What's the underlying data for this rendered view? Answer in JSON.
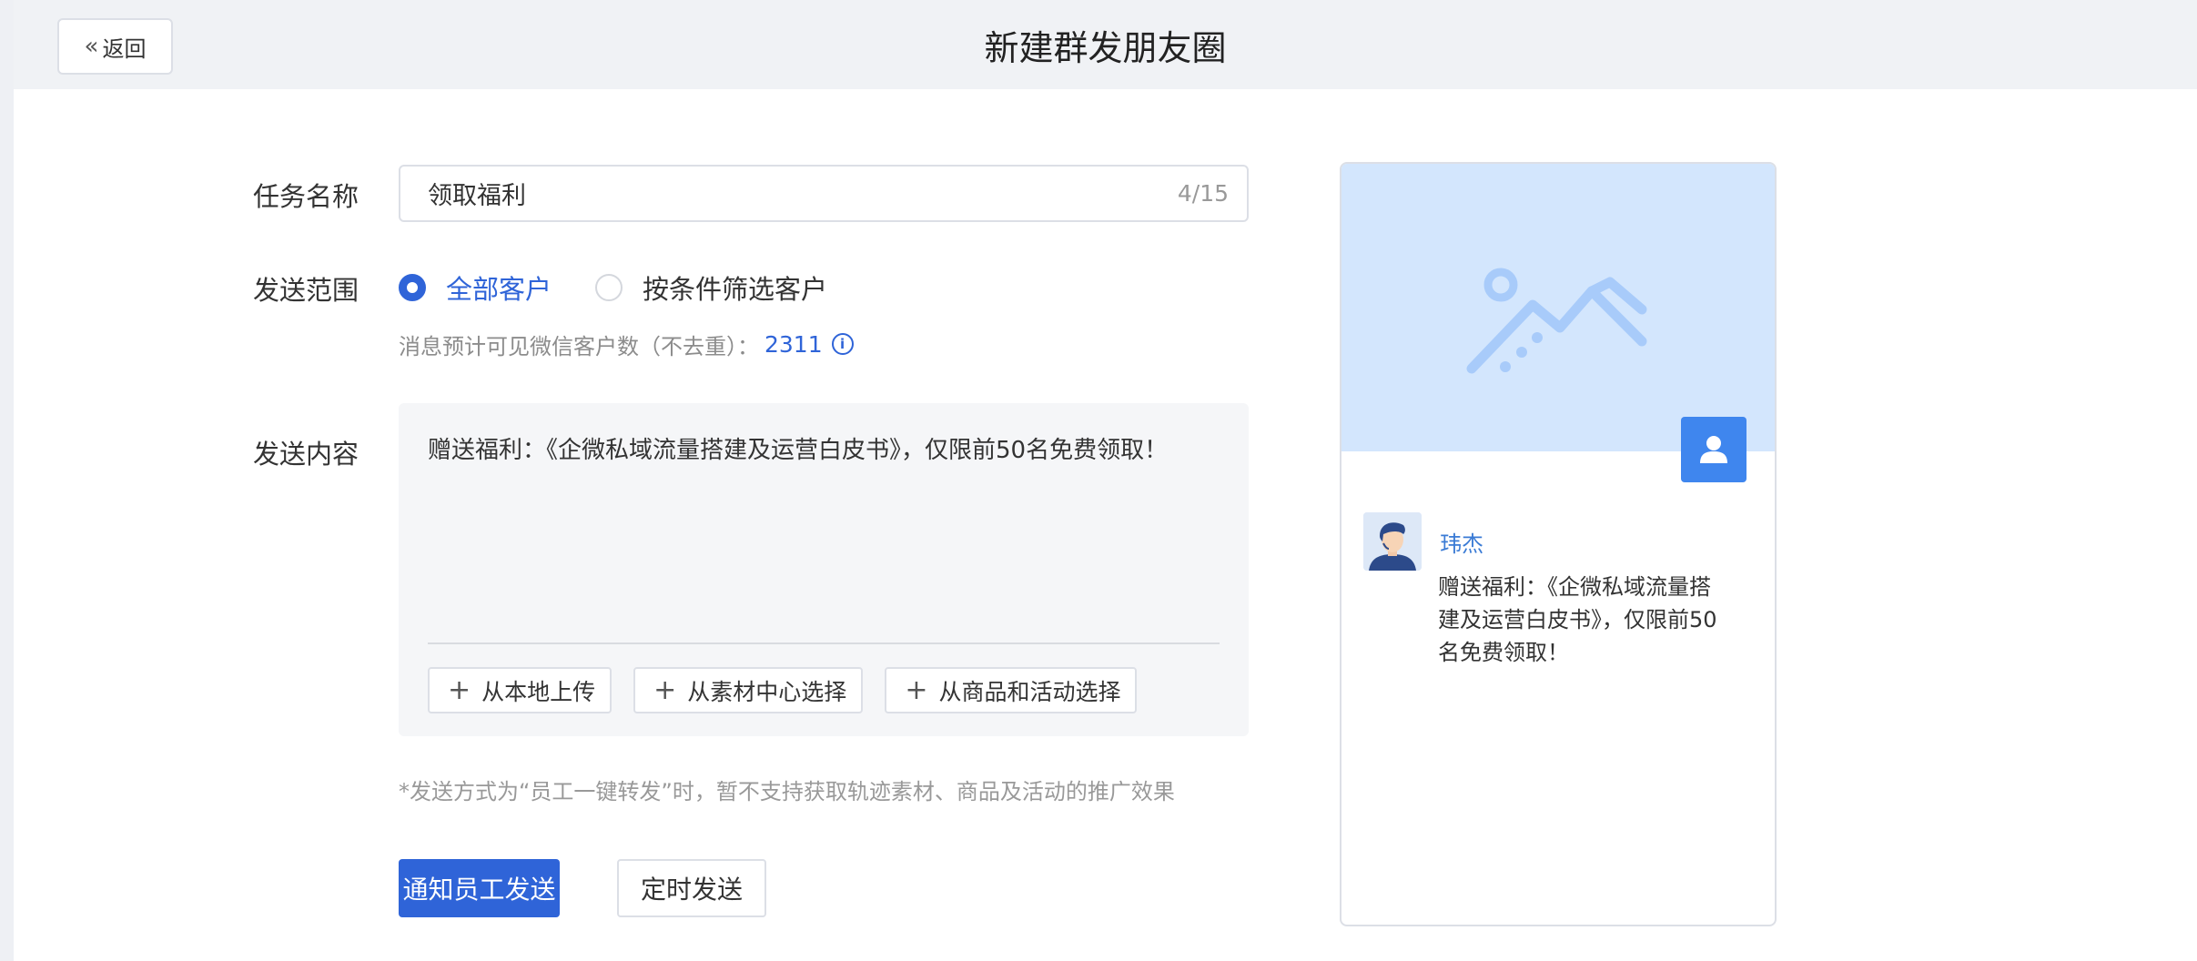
{
  "header": {
    "back_label": "返回",
    "title": "新建群发朋友圈"
  },
  "form": {
    "task_name": {
      "label": "任务名称",
      "value": "领取福利",
      "counter": "4/15"
    },
    "scope": {
      "label": "发送范围",
      "options": [
        {
          "label": "全部客户",
          "selected": true
        },
        {
          "label": "按条件筛选客户",
          "selected": false
        }
      ],
      "hint_label": "消息预计可见微信客户数（不去重）：",
      "hint_count": "2311"
    },
    "content": {
      "label": "发送内容",
      "text": "赠送福利：《企微私域流量搭建及运营白皮书》，仅限前50名免费领取！",
      "upload_buttons": [
        "从本地上传",
        "从素材中心选择",
        "从商品和活动选择"
      ]
    },
    "note": "*发送方式为“员工一键转发”时，暂不支持获取轨迹素材、商品及活动的推广效果",
    "actions": {
      "primary": "通知员工发送",
      "secondary": "定时发送"
    }
  },
  "preview": {
    "user_name": "玮杰",
    "post_text": "赠送福利：《企微私域流量搭建及运营白皮书》，仅限前50名免费领取！"
  },
  "colors": {
    "primary": "#2f64d8",
    "cover_bg": "#d3e6fd",
    "badge": "#3f86ee"
  }
}
